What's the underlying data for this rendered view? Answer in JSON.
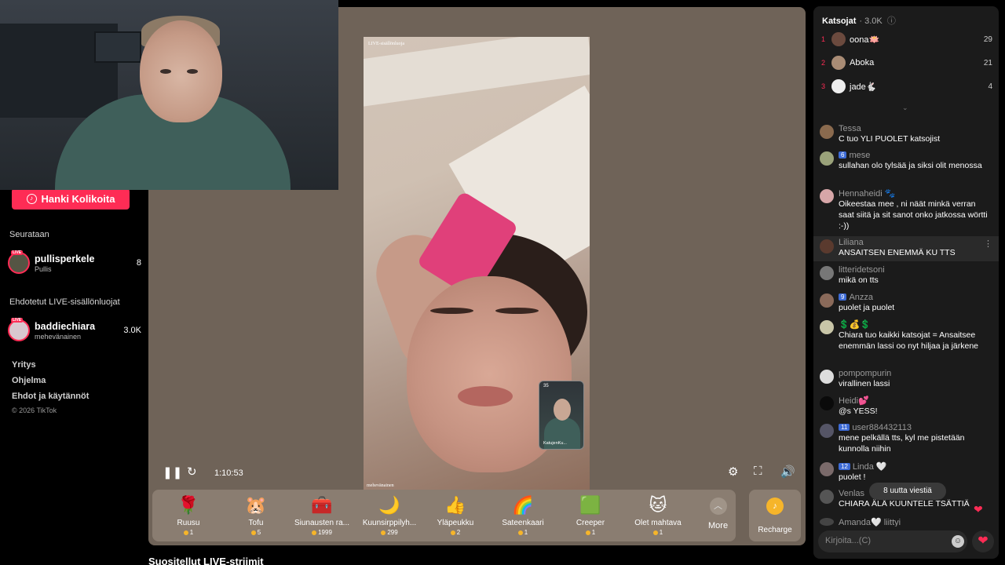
{
  "sidebar": {
    "coin_button": "Hanki Kolikoita",
    "following_heading": "Seurataan",
    "following": [
      {
        "name": "pullisperkele",
        "sub": "Pullis",
        "count": "8"
      }
    ],
    "suggested_heading": "Ehdotetut LIVE-sisällönluojat",
    "suggested": [
      {
        "name": "baddiechiara",
        "sub": "mehevänainen",
        "count": "3.0K"
      }
    ],
    "footer_links": [
      "Yritys",
      "Ohjelma",
      "Ehdot ja käytännöt"
    ],
    "copyright": "© 2026 TikTok",
    "live_badge": "LIVE"
  },
  "player": {
    "video_tag_top": "LIVE-sisällönluoja",
    "video_tag_bottom": "mehevänainen",
    "pip_viewers": "35",
    "pip_name": "KatujenKu...",
    "time": "1:10:53"
  },
  "gifts": [
    {
      "name": "Ruusu",
      "price": "1",
      "icon": "🌹"
    },
    {
      "name": "Tofu",
      "price": "5",
      "icon": "🐹"
    },
    {
      "name": "Siunausten ra...",
      "price": "1999",
      "icon": "🧰"
    },
    {
      "name": "Kuunsirppilyh...",
      "price": "299",
      "icon": "🌙"
    },
    {
      "name": "Yläpeukku",
      "price": "2",
      "icon": "👍"
    },
    {
      "name": "Sateenkaari",
      "price": "1",
      "icon": "🌈"
    },
    {
      "name": "Creeper",
      "price": "1",
      "icon": "🟩"
    },
    {
      "name": "Olet mahtava",
      "price": "1",
      "icon": "🐱"
    }
  ],
  "gift_more": "More",
  "recharge": "Recharge",
  "recommended_heading": "Suositellut LIVE-striimit",
  "chat": {
    "viewers_title": "Katsojat",
    "viewers_count": "· 3.0K",
    "ranking": [
      {
        "rank": "1",
        "name": "oona🪷",
        "score": "29"
      },
      {
        "rank": "2",
        "name": "Aboka",
        "score": "21"
      },
      {
        "rank": "3",
        "name": "jade🐇",
        "score": "4"
      }
    ],
    "messages": [
      {
        "user": "Tessa",
        "badge": "",
        "text": "C tuo YLI PUOLET katsojist"
      },
      {
        "user": "mese",
        "badge": "6",
        "text": "sullahan olo tylsää ja siksi olit menossa"
      },
      {
        "user": "Hennaheidi 🐾",
        "badge": "",
        "text": "Oikeestaa mee , ni näät minkä verran saat siitä ja sit sanot onko jatkossa wörtti :-))"
      },
      {
        "user": "Liliana",
        "badge": "",
        "text": "ANSAITSEN ENEMMÄ KU TTS"
      },
      {
        "user": "litteridetsoni",
        "badge": "",
        "text": "mikä on tts"
      },
      {
        "user": "Anzza",
        "badge": "9",
        "text": "puolet ja puolet"
      },
      {
        "user": "💲💰💲",
        "badge": "",
        "text": "Chiara tuo kaikki katsojat = Ansaitsee enemmän lassi oo nyt hiljaa ja järkene"
      },
      {
        "user": "pompompurin",
        "badge": "",
        "text": "virallinen lassi"
      },
      {
        "user": "Heidi💕",
        "badge": "",
        "text": "@s YESS!"
      },
      {
        "user": "user884432113",
        "badge": "11",
        "text": "mene pelkällä tts, kyl me pistetään kunnolla niihin"
      },
      {
        "user": "Linda 🤍",
        "badge": "12",
        "text": "puolet !"
      },
      {
        "user": "Venlas",
        "badge": "",
        "text": "CHIARA ÄLÄ KUUNTELE TSÄTTIÄ"
      },
      {
        "user": "Amanda🤍 liittyi",
        "badge": "",
        "text": ""
      }
    ],
    "new_messages": "8 uutta viestiä",
    "input_placeholder": "Kirjoita...(C)"
  }
}
